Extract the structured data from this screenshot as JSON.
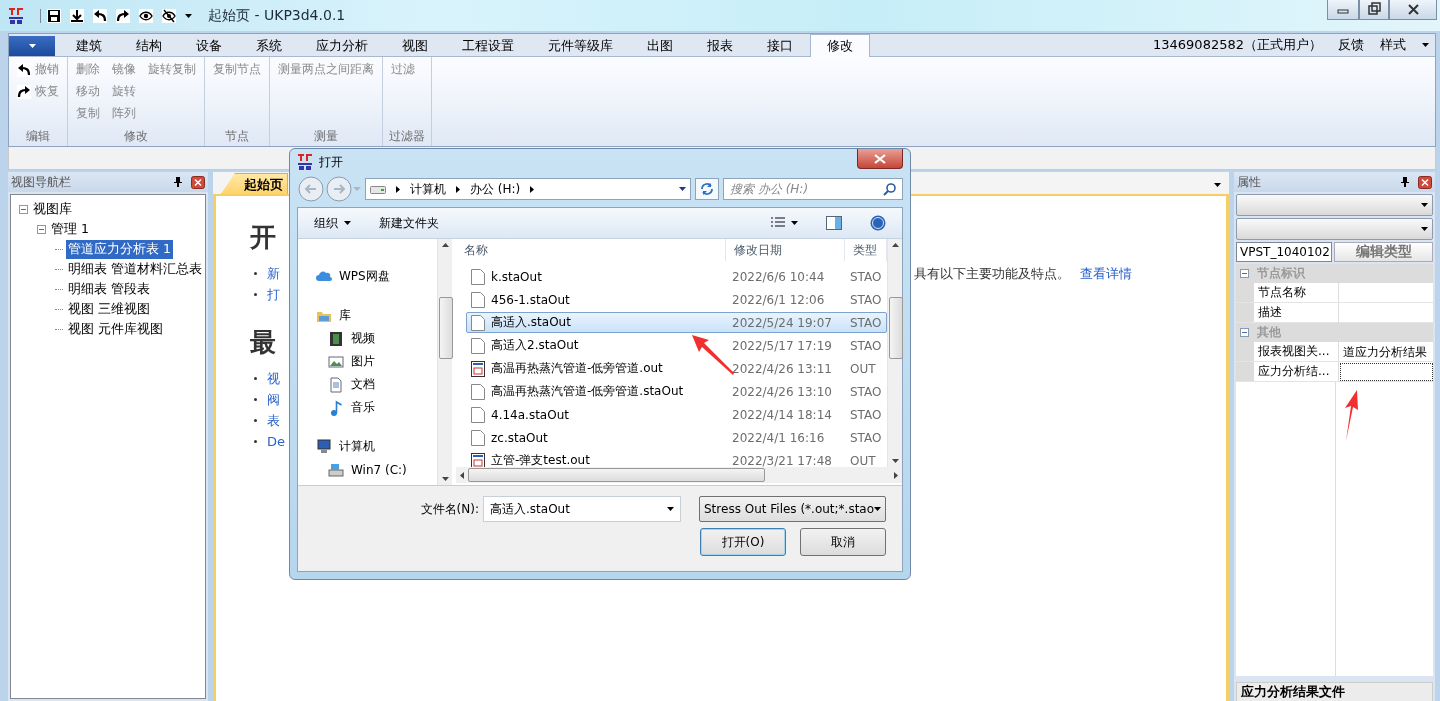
{
  "window": {
    "title": "起始页 - UKP3d4.0.1"
  },
  "ribbon": {
    "tabs": [
      {
        "label": "建筑",
        "selected": false
      },
      {
        "label": "结构",
        "selected": false
      },
      {
        "label": "设备",
        "selected": false
      },
      {
        "label": "系统",
        "selected": false
      },
      {
        "label": "应力分析",
        "selected": false
      },
      {
        "label": "视图",
        "selected": false
      },
      {
        "label": "工程设置",
        "selected": false
      },
      {
        "label": "元件等级库",
        "selected": false
      },
      {
        "label": "出图",
        "selected": false
      },
      {
        "label": "报表",
        "selected": false
      },
      {
        "label": "接口",
        "selected": false
      },
      {
        "label": "修改",
        "selected": true
      }
    ],
    "account": "13469082582（正式用户）",
    "feedback": "反馈",
    "style_menu": "样式",
    "groups": [
      {
        "label": "编辑",
        "columns": [
          [
            {
              "label": "撤销",
              "kind": "undo",
              "disabled": true
            },
            {
              "label": "恢复",
              "kind": "redo",
              "disabled": true
            }
          ]
        ]
      },
      {
        "label": "修改",
        "columns": [
          [
            {
              "label": "删除",
              "kind": "text",
              "disabled": true
            },
            {
              "label": "移动",
              "kind": "text",
              "disabled": true
            },
            {
              "label": "复制",
              "kind": "text",
              "disabled": true
            }
          ],
          [
            {
              "label": "镜像",
              "kind": "text",
              "disabled": true
            },
            {
              "label": "旋转",
              "kind": "text",
              "disabled": true
            },
            {
              "label": "阵列",
              "kind": "text",
              "disabled": true
            }
          ],
          [
            {
              "label": "旋转复制",
              "kind": "text",
              "disabled": true
            }
          ]
        ]
      },
      {
        "label": "节点",
        "columns": [
          [
            {
              "label": "复制节点",
              "kind": "text",
              "disabled": true
            }
          ]
        ]
      },
      {
        "label": "测量",
        "columns": [
          [
            {
              "label": "测量两点之间距离",
              "kind": "text",
              "disabled": true
            }
          ]
        ]
      },
      {
        "label": "过滤器",
        "columns": [
          [
            {
              "label": "过滤",
              "kind": "text",
              "disabled": true
            }
          ]
        ]
      }
    ]
  },
  "navigator": {
    "title": "视图导航栏",
    "tree": [
      {
        "label": "视图库",
        "expanded": true,
        "selected": false,
        "children": [
          {
            "label": "管理 1",
            "expanded": true,
            "selected": false,
            "children": [
              {
                "label": "管道应力分析表 1",
                "selected": true
              },
              {
                "label": "明细表 管道材料汇总表",
                "selected": false
              },
              {
                "label": "明细表 管段表",
                "selected": false
              },
              {
                "label": "视图 三维视图",
                "selected": false
              },
              {
                "label": "视图 元件库视图",
                "selected": false
              }
            ]
          }
        ]
      }
    ]
  },
  "start_page": {
    "tab": "起始页",
    "heading_1": "开",
    "links_1": [
      "新",
      "打"
    ],
    "intro_tail": "具有以下主要功能及特点。",
    "details_link": "查看详情",
    "heading_2": "最",
    "links_2": [
      "视",
      "阀",
      "表",
      "De"
    ]
  },
  "properties": {
    "title": "属性",
    "type_select": "VPST_1040102",
    "edit_type_button": "编辑类型",
    "sections": [
      {
        "label": "节点标识",
        "expanded": true,
        "rows": [
          {
            "name": "节点名称",
            "focused": false
          },
          {
            "name": "描述",
            "focused": false
          }
        ]
      },
      {
        "label": "其他",
        "expanded": true,
        "rows": [
          {
            "name": "报表视图关...",
            "value": "道应力分析结果",
            "focused": false
          },
          {
            "name": "应力分析结...",
            "focused": true
          }
        ]
      }
    ],
    "footer_title": "应力分析结果文件"
  },
  "dialog": {
    "title": "打开",
    "breadcrumb": [
      "计算机",
      "办公 (H:)"
    ],
    "search_placeholder": "搜索 办公 (H:)",
    "toolbar": {
      "organize": "组织",
      "new_folder": "新建文件夹"
    },
    "sidebar": [
      {
        "label": "WPS网盘",
        "kind": "cloud"
      },
      {
        "label": "库",
        "kind": "library",
        "children": [
          {
            "label": "视频",
            "kind": "video"
          },
          {
            "label": "图片",
            "kind": "image"
          },
          {
            "label": "文档",
            "kind": "document"
          },
          {
            "label": "音乐",
            "kind": "music"
          }
        ]
      },
      {
        "label": "计算机",
        "kind": "computer",
        "children": [
          {
            "label": "Win7 (C:)",
            "kind": "drive"
          }
        ]
      }
    ],
    "columns": [
      "名称",
      "修改日期",
      "类型"
    ],
    "files": [
      {
        "name": "k.staOut",
        "date": "2022/6/6 10:44",
        "type": "STAO",
        "kind": "plain",
        "selected": false
      },
      {
        "name": "456-1.staOut",
        "date": "2022/6/1 12:06",
        "type": "STAO",
        "kind": "plain",
        "selected": false
      },
      {
        "name": "高适入.staOut",
        "date": "2022/5/24 19:07",
        "type": "STAO",
        "kind": "plain",
        "selected": true
      },
      {
        "name": "高适入2.staOut",
        "date": "2022/5/17 17:19",
        "type": "STAO",
        "kind": "plain",
        "selected": false
      },
      {
        "name": "高温再热蒸汽管道-低旁管道.out",
        "date": "2022/4/26 13:11",
        "type": "OUT",
        "kind": "out",
        "selected": false
      },
      {
        "name": "高温再热蒸汽管道-低旁管道.staOut",
        "date": "2022/4/26 13:10",
        "type": "STAO",
        "kind": "plain",
        "selected": false
      },
      {
        "name": "4.14a.staOut",
        "date": "2022/4/14 18:14",
        "type": "STAO",
        "kind": "plain",
        "selected": false
      },
      {
        "name": "zc.staOut",
        "date": "2022/4/1 16:16",
        "type": "STAO",
        "kind": "plain",
        "selected": false
      },
      {
        "name": "立管-弹支test.out",
        "date": "2022/3/21 17:48",
        "type": "OUT",
        "kind": "out",
        "selected": false
      }
    ],
    "filename_label": "文件名(N):",
    "filename": "高适入.staOut",
    "filter": "Stress Out Files (*.out;*.stao",
    "buttons": [
      {
        "label": "打开(O)",
        "kind": "default"
      },
      {
        "label": "取消",
        "kind": "normal"
      }
    ]
  }
}
